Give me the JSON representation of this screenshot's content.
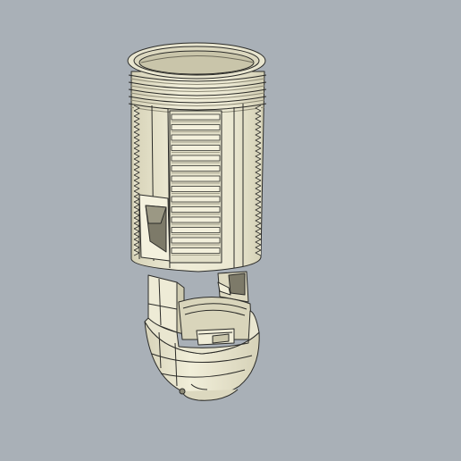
{
  "scene": {
    "background_color": "#a9b0b7",
    "model_fill": "#ece9d4",
    "model_shade": "#d9d5bb",
    "model_dark": "#8d8a77",
    "edge_color": "#2b2b28",
    "parts": [
      {
        "name": "lamp-socket-threaded-sleeve"
      },
      {
        "name": "lamp-socket-inner-contact-piece"
      },
      {
        "name": "lamp-socket-hemispherical-cap"
      }
    ]
  }
}
